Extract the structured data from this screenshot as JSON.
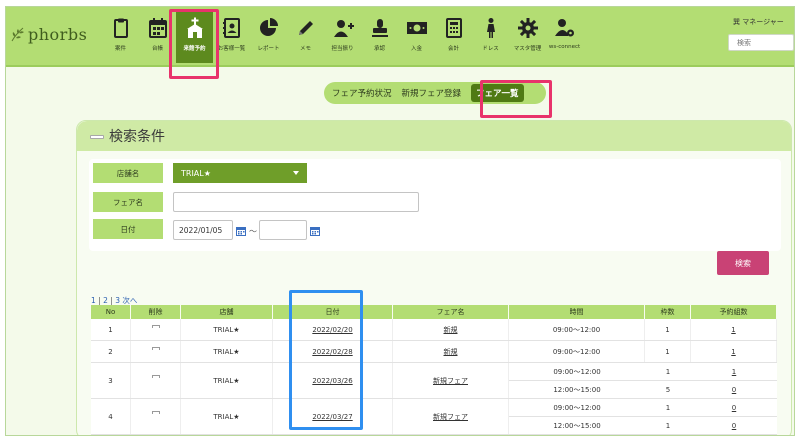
{
  "brand": {
    "logo_text": "phorbs"
  },
  "nav": {
    "items": [
      {
        "label": "案件",
        "icon": "clipboard-icon"
      },
      {
        "label": "台帳",
        "icon": "calendar-icon"
      },
      {
        "label": "来館予約",
        "icon": "chapel-icon",
        "active": true
      },
      {
        "label": "お客様一覧",
        "icon": "address-book-icon"
      },
      {
        "label": "レポート",
        "icon": "pie-chart-icon"
      },
      {
        "label": "メモ",
        "icon": "pencil-icon"
      },
      {
        "label": "担当振り",
        "icon": "user-plus-icon"
      },
      {
        "label": "承認",
        "icon": "stamp-icon"
      },
      {
        "label": "入金",
        "icon": "money-icon"
      },
      {
        "label": "会計",
        "icon": "calculator-icon"
      },
      {
        "label": "ドレス",
        "icon": "dress-icon"
      },
      {
        "label": "マスタ管理",
        "icon": "gear-icon"
      },
      {
        "label": "ws-connect",
        "icon": "users-gear-icon"
      }
    ]
  },
  "header": {
    "user_name": "巽 マネージャー",
    "search_placeholder": "検索"
  },
  "subnav": {
    "tabs": [
      {
        "label": "フェア予約状況"
      },
      {
        "label": "新規フェア登録"
      },
      {
        "label": "フェア一覧",
        "active": true
      }
    ]
  },
  "search_panel": {
    "title": "検索条件",
    "store_label": "店舗名",
    "store_value": "TRIAL★",
    "fair_label": "フェア名",
    "fair_value": "",
    "date_label": "日付",
    "date_from": "2022/01/05",
    "date_sep": "〜",
    "date_to": "",
    "search_button": "検索"
  },
  "pager": {
    "p1": "1",
    "sep1": "|",
    "p2": "2",
    "sep2": "|",
    "p3": "3",
    "next": "次へ"
  },
  "table": {
    "headers": [
      "No",
      "削除",
      "店舗",
      "日付",
      "フェア名",
      "時間",
      "枠数",
      "予約組数"
    ],
    "rows": [
      {
        "no": "1",
        "store": "TRIAL★",
        "date": "2022/02/20",
        "fair": "新規",
        "slots": [
          {
            "time": "09:00〜12:00",
            "frames": "1",
            "reserved": "1"
          }
        ]
      },
      {
        "no": "2",
        "store": "TRIAL★",
        "date": "2022/02/28",
        "fair": "新規",
        "slots": [
          {
            "time": "09:00〜12:00",
            "frames": "1",
            "reserved": "1"
          }
        ]
      },
      {
        "no": "3",
        "store": "TRIAL★",
        "date": "2022/03/26",
        "fair": "新規フェア",
        "slots": [
          {
            "time": "09:00〜12:00",
            "frames": "1",
            "reserved": "1"
          },
          {
            "time": "12:00〜15:00",
            "frames": "5",
            "reserved": "0"
          }
        ]
      },
      {
        "no": "4",
        "store": "TRIAL★",
        "date": "2022/03/27",
        "fair": "新規フェア",
        "slots": [
          {
            "time": "09:00〜12:00",
            "frames": "1",
            "reserved": "0"
          },
          {
            "time": "12:00〜15:00",
            "frames": "1",
            "reserved": "0"
          }
        ]
      }
    ]
  },
  "colors": {
    "header_green": "#b3dd73",
    "active_green": "#5d8a1e",
    "search_button": "#c94275",
    "highlight_pink": "#e8336b",
    "highlight_blue": "#2f8ff0"
  }
}
